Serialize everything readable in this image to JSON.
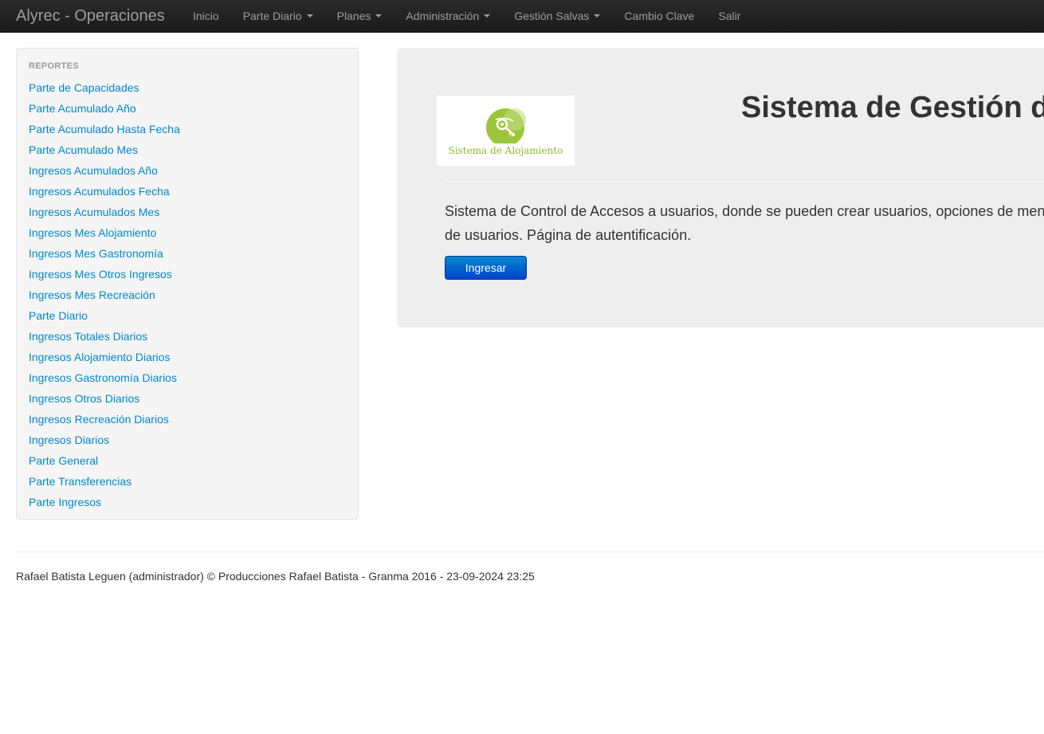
{
  "navbar": {
    "brand": "Alyrec - Operaciones",
    "items": [
      {
        "label": "Inicio",
        "dropdown": false
      },
      {
        "label": "Parte Diario",
        "dropdown": true
      },
      {
        "label": "Planes",
        "dropdown": true
      },
      {
        "label": "Administración",
        "dropdown": true
      },
      {
        "label": "Gestión Salvas",
        "dropdown": true
      },
      {
        "label": "Cambio Clave",
        "dropdown": false
      },
      {
        "label": "Salir",
        "dropdown": false
      }
    ]
  },
  "sidebar": {
    "header": "REPORTES",
    "items": [
      "Parte de Capacidades",
      "Parte Acumulado Año",
      "Parte Acumulado Hasta Fecha",
      "Parte Acumulado Mes",
      "Ingresos Acumulados Año",
      "Ingresos Acumulados Fecha",
      "Ingresos Acumulados Mes",
      "Ingresos Mes Alojamiento",
      "Ingresos Mes Gastronomía",
      "Ingresos Mes Otros Ingresos",
      "Ingresos Mes Recreación",
      "Parte Diario",
      "Ingresos Totales Diarios",
      "Ingresos Alojamiento Diarios",
      "Ingresos Gastronomía Diarios",
      "Ingresos Otros Diarios",
      "Ingresos Recreación Diarios",
      "Ingresos Diarios",
      "Parte General",
      "Parte Transferencias",
      "Parte Ingresos"
    ]
  },
  "hero": {
    "logo_text": "Sistema de Alojamiento",
    "title": "Sistema de Gestión d",
    "description": "Sistema de Control de Accesos a usuarios, donde se pueden crear usuarios, opciones de men de usuarios. Página de autentificación.",
    "description_line1": "Sistema de Control de Accesos a usuarios, donde se pueden crear usuarios, opciones de men",
    "description_line2": "de usuarios. Página de autentificación.",
    "button_label": "Ingresar"
  },
  "footer": {
    "text": "Rafael Batista Leguen (administrador) © Producciones Rafael Batista - Granma 2016 - 23-09-2024 23:25"
  },
  "colors": {
    "navbar_bg": "#1b1b1b",
    "link": "#0088cc",
    "button": "#0044cc",
    "logo_green": "#8dbb2a"
  }
}
